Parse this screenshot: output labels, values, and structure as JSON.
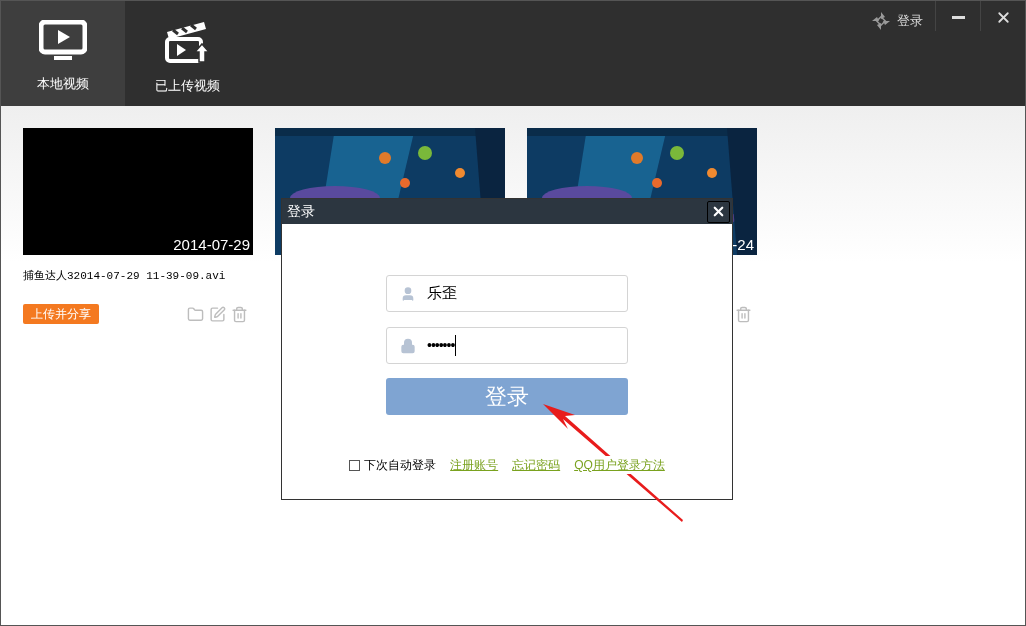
{
  "tabs": [
    {
      "label": "本地视频",
      "selected": true
    },
    {
      "label": "已上传视频",
      "selected": false
    }
  ],
  "header": {
    "login": "登录"
  },
  "cards": [
    {
      "kind": "blank",
      "date": "2014-07-29",
      "title": "捕鱼达人32014-07-29 11-39-09.avi",
      "share": "上传并分享",
      "actions": [
        {
          "kind": "folder"
        },
        {
          "kind": "edit"
        },
        {
          "kind": "trash"
        }
      ]
    },
    {
      "kind": "picture"
    },
    {
      "kind": "picture",
      "date": "-24",
      "actions": [
        {
          "kind": "trash"
        }
      ]
    }
  ],
  "dialog": {
    "title": "登录",
    "username": "乐歪",
    "password": "•••••••",
    "submit": "登录",
    "auto_login": {
      "label": "下次自动登录",
      "checked": false
    },
    "links": [
      "注册账号",
      "忘记密码",
      "QQ用户登录方法"
    ]
  }
}
